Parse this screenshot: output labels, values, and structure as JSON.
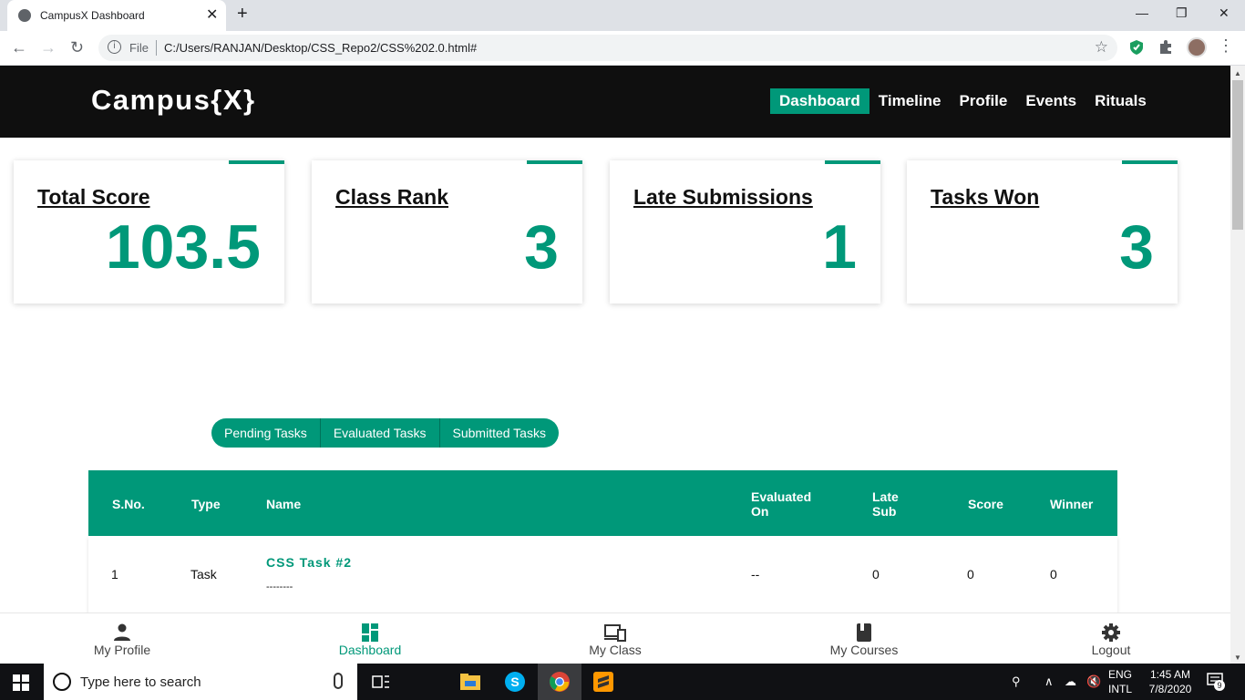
{
  "browser": {
    "tab_title": "CampusX Dashboard",
    "new_tab": "+",
    "file_label": "File",
    "url": "C:/Users/RANJAN/Desktop/CSS_Repo2/CSS%202.0.html#"
  },
  "site": {
    "logo": "Campus{X}",
    "nav": [
      "Dashboard",
      "Timeline",
      "Profile",
      "Events",
      "Rituals"
    ],
    "active_nav": "Dashboard",
    "accent_color": "#009879"
  },
  "cards": [
    {
      "label": "Total Score",
      "value": "103.5"
    },
    {
      "label": "Class Rank",
      "value": "3"
    },
    {
      "label": "Late Submissions",
      "value": "1"
    },
    {
      "label": "Tasks Won",
      "value": "3"
    }
  ],
  "task_tabs": [
    "Pending Tasks",
    "Evaluated Tasks",
    "Submitted Tasks"
  ],
  "table": {
    "headers": {
      "sno": "S.No.",
      "type": "Type",
      "name": "Name",
      "evaluated_1": "Evaluated",
      "evaluated_2": "On",
      "late_1": "Late",
      "late_2": "Sub",
      "score": "Score",
      "winner": "Winner"
    },
    "rows": [
      {
        "sno": "1",
        "type": "Task",
        "name": "CSS Task #2",
        "name_sub": "--------",
        "evaluated_on": "--",
        "late_sub": "0",
        "score": "0",
        "winner": "0"
      }
    ]
  },
  "bottom_nav": [
    {
      "label": "My Profile",
      "icon": "person-icon"
    },
    {
      "label": "Dashboard",
      "icon": "dashboard-icon"
    },
    {
      "label": "My Class",
      "icon": "devices-icon"
    },
    {
      "label": "My Courses",
      "icon": "book-icon"
    },
    {
      "label": "Logout",
      "icon": "gear-icon"
    }
  ],
  "taskbar": {
    "search_placeholder": "Type here to search",
    "lang_1": "ENG",
    "lang_2": "INTL",
    "time": "1:45 AM",
    "date": "7/8/2020",
    "notifications": "9"
  }
}
